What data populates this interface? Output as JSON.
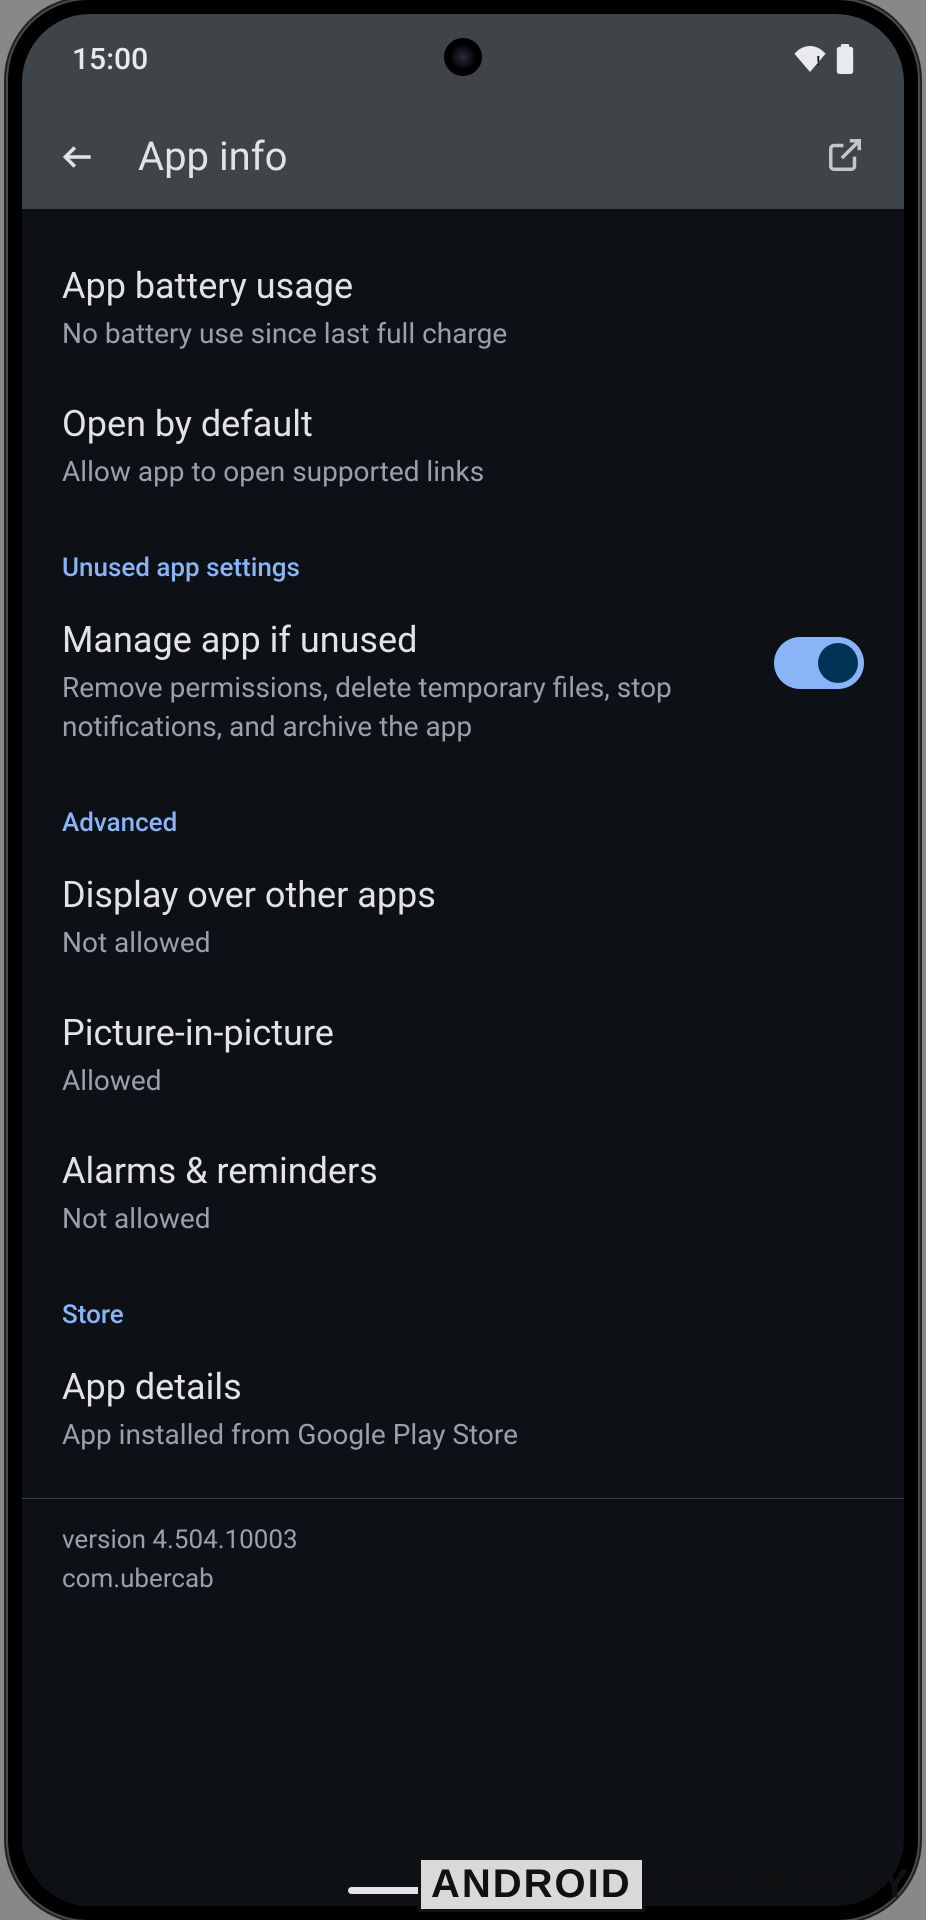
{
  "status": {
    "time": "15:00"
  },
  "header": {
    "title": "App info"
  },
  "items": {
    "battery": {
      "title": "App battery usage",
      "sub": "No battery use since last full charge"
    },
    "open_default": {
      "title": "Open by default",
      "sub": "Allow app to open supported links"
    }
  },
  "sections": {
    "unused": {
      "label": "Unused app settings",
      "manage": {
        "title": "Manage app if unused",
        "sub": "Remove permissions, delete temporary files, stop notifications, and archive the app",
        "toggle": true
      }
    },
    "advanced": {
      "label": "Advanced",
      "display_over": {
        "title": "Display over other apps",
        "sub": "Not allowed"
      },
      "pip": {
        "title": "Picture-in-picture",
        "sub": "Allowed"
      },
      "alarms": {
        "title": "Alarms & reminders",
        "sub": "Not allowed"
      }
    },
    "store": {
      "label": "Store",
      "details": {
        "title": "App details",
        "sub": "App installed from Google Play Store"
      }
    }
  },
  "footer": {
    "version": "version 4.504.10003",
    "package": "com.ubercab"
  },
  "watermark": {
    "a": "ANDROID",
    "b": "AUTHORITY"
  }
}
